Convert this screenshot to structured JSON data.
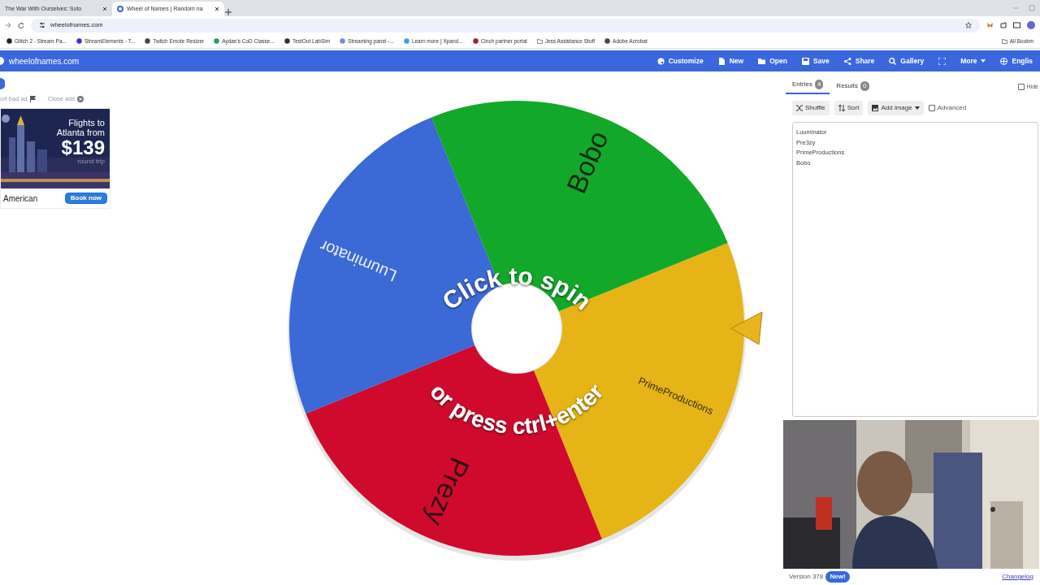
{
  "browser": {
    "tabs": [
      {
        "title": "The War With Ourselves: Soto",
        "selected": false
      },
      {
        "title": "Wheel of Names | Random na",
        "selected": true
      }
    ],
    "address": "wheelofnames.com",
    "bookmarks": [
      "Glitch 2 - Stream Pa...",
      "StreamElements - T...",
      "Twitch Emote Resizer",
      "Aydan's CoD Classe...",
      "TestOut LabSim",
      "Streaming panel -...",
      "Learn more | Xpand...",
      "Cinch partner portal",
      "Jess Assistance Stuff",
      "Adobe Acrobat"
    ],
    "all_bookmarks": "All Bookm"
  },
  "navbar": {
    "brand": "wheelofnames.com",
    "items": [
      {
        "label": "Customize",
        "kind": "palette"
      },
      {
        "label": "New",
        "kind": "file"
      },
      {
        "label": "Open",
        "kind": "folder"
      },
      {
        "label": "Save",
        "kind": "disk"
      },
      {
        "label": "Share",
        "kind": "share"
      },
      {
        "label": "Gallery",
        "kind": "search"
      },
      {
        "kind": "fullscreen"
      },
      {
        "label": "More",
        "kind": "more"
      },
      {
        "label": "Englis",
        "kind": "globe"
      }
    ]
  },
  "ads": {
    "report": "ort bad ad",
    "close": "Close ads",
    "headline": "Flights to Atlanta from",
    "price": "$139",
    "note": "round trip",
    "brand": "American",
    "cta": "Book now"
  },
  "wheel": {
    "slices": [
      {
        "label": "PrimeProductions",
        "color": "#e6b417"
      },
      {
        "label": "Prezy",
        "color": "#cf0a2c"
      },
      {
        "label": "Luuminator",
        "color": "#3b69d6"
      },
      {
        "label": "Bobo",
        "color": "#12a82a"
      }
    ],
    "prompt_top": "Click to spin",
    "prompt_bottom": "or press ctrl+enter"
  },
  "panel": {
    "tabs": [
      {
        "label": "Entries",
        "count": "4",
        "selected": true
      },
      {
        "label": "Results",
        "count": "0",
        "selected": false
      }
    ],
    "hide": {
      "label": "Hide",
      "checked": false
    },
    "tools": [
      "Shuffle",
      "Sort",
      "Add image"
    ],
    "advanced": {
      "label": "Advanced",
      "checked": false
    },
    "entries": [
      "Luuminator",
      "Pre3zy",
      "PrimeProductions",
      "Bobo"
    ],
    "version": "Version 378",
    "badge": "New!",
    "changelog": "Changelog"
  }
}
